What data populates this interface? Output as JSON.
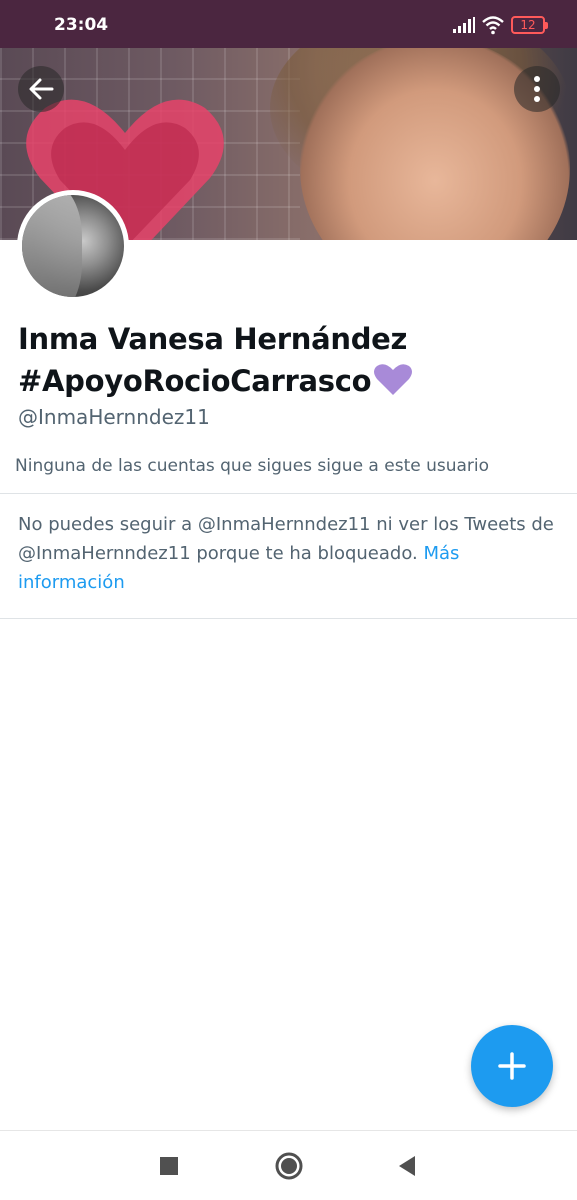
{
  "status_bar": {
    "time": "23:04",
    "battery": "12",
    "icons": [
      "signal-icon",
      "wifi-icon",
      "battery-icon"
    ]
  },
  "header": {
    "back_icon": "back-arrow-icon",
    "more_icon": "more-vertical-icon"
  },
  "profile": {
    "name_line1": "Inma Vanesa Hernández",
    "name_line2": "#ApoyoRocioCarrasco",
    "name_emoji": "purple-heart-icon",
    "handle": "@InmaHernndez11",
    "followers_note": "Ninguna de las cuentas que sigues sigue a este usuario"
  },
  "blocked": {
    "message": "No puedes seguir a @InmaHernndez11 ni ver los Tweets de @InmaHernndez11 porque te ha bloqueado. ",
    "link": "Más información"
  },
  "fab": {
    "icon": "plus-icon"
  },
  "nav_bar": {
    "icons": [
      "recents-icon",
      "home-icon",
      "back-icon"
    ]
  },
  "colors": {
    "status_bar": "#4b2640",
    "accent": "#1d9bf0",
    "text_primary": "#0f1419",
    "text_secondary": "#536471",
    "emoji_purple": "#a88ad8"
  }
}
